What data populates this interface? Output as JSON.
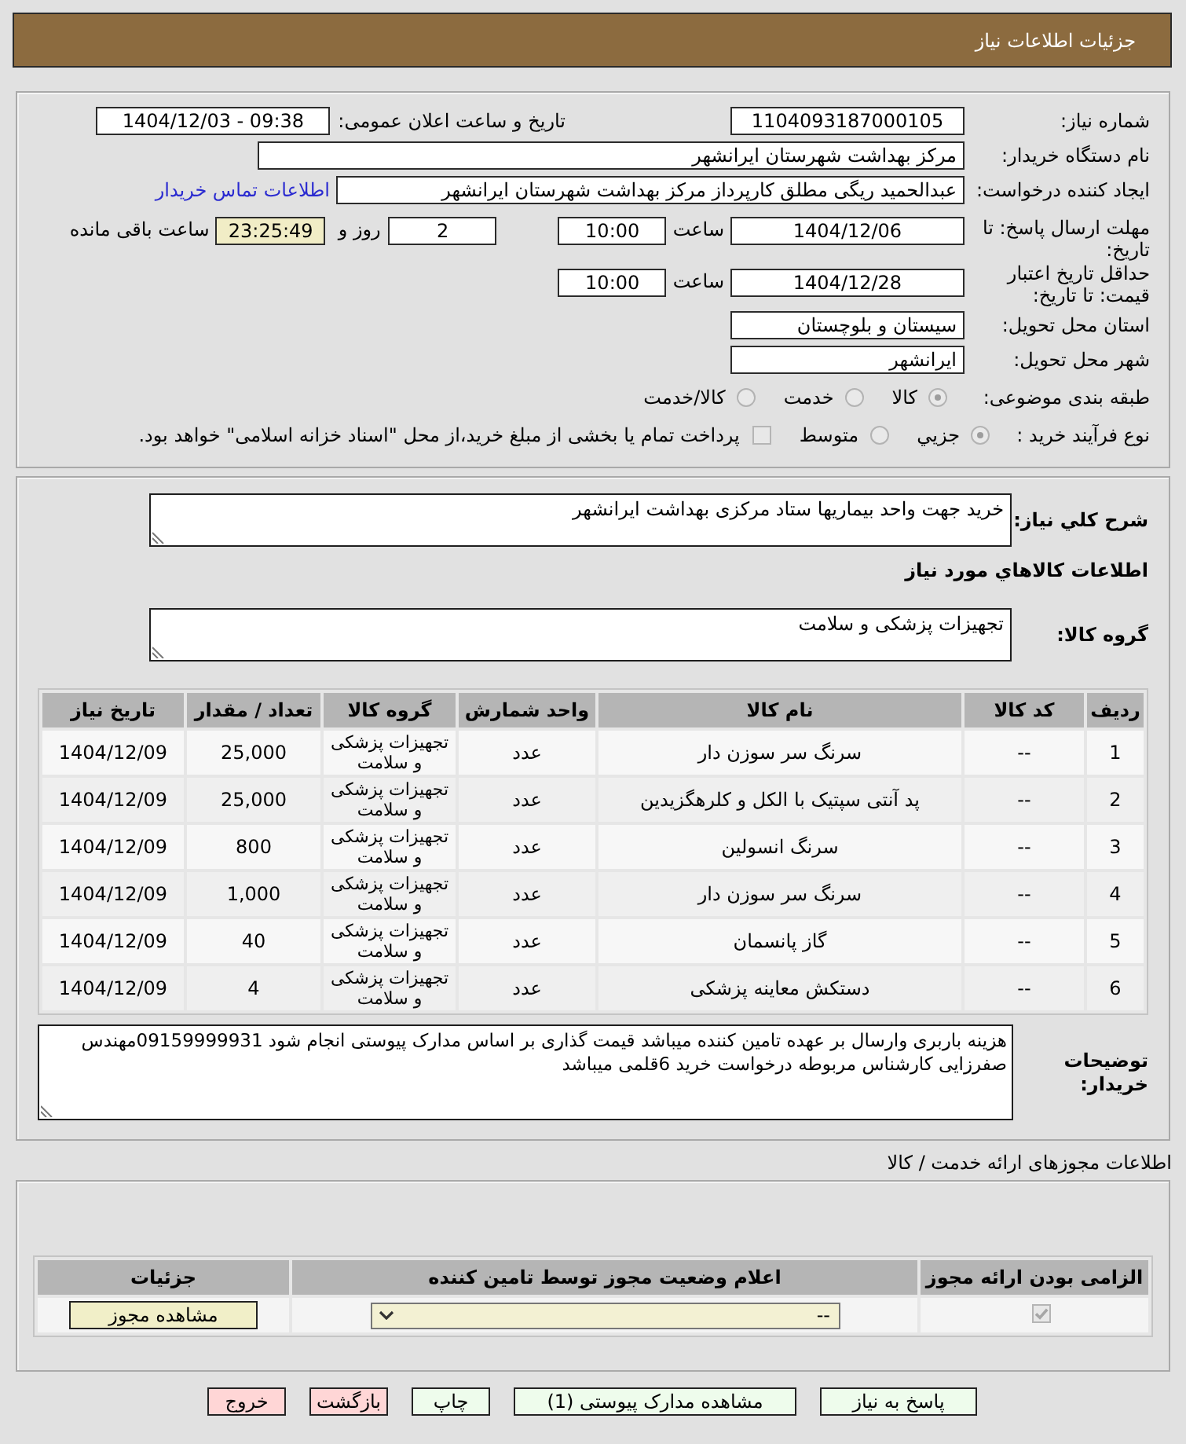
{
  "header": {
    "title": "جزئیات اطلاعات نیاز"
  },
  "details": {
    "need_number": {
      "label": "شماره نیاز:",
      "value": "1104093187000105"
    },
    "announce_date": {
      "label": "تاریخ و ساعت اعلان عمومی:",
      "value": "1404/12/03 - 09:38"
    },
    "buyer_org": {
      "label": "نام دستگاه خریدار:",
      "value": "مرکز بهداشت شهرستان ایرانشهر"
    },
    "requester": {
      "label": "ایجاد کننده درخواست:",
      "value": "عبدالحمید ریگی مطلق کارپرداز مرکز بهداشت شهرستان ایرانشهر",
      "contact_link": "اطلاعات تماس خریدار"
    },
    "reply_deadline": {
      "label": "مهلت ارسال پاسخ: تا تاریخ:",
      "date": "1404/12/06",
      "time_label": "ساعت",
      "time": "10:00",
      "days": "2",
      "days_label": "روز و",
      "remaining": "23:25:49",
      "remaining_label": "ساعت باقی مانده"
    },
    "price_validity": {
      "label": "حداقل تاریخ اعتبار قیمت: تا تاریخ:",
      "date": "1404/12/28",
      "time_label": "ساعت",
      "time": "10:00"
    },
    "delivery_province": {
      "label": "استان محل تحویل:",
      "value": "سیستان و بلوچستان"
    },
    "delivery_city": {
      "label": "شهر محل تحویل:",
      "value": "ایرانشهر"
    },
    "subject_category": {
      "label": "طبقه بندی موضوعی:",
      "options": [
        {
          "label": "کالا",
          "selected": true,
          "disabled": true
        },
        {
          "label": "خدمت",
          "selected": false,
          "disabled": true
        },
        {
          "label": "کالا/خدمت",
          "selected": false,
          "disabled": true
        }
      ]
    },
    "purchase_process": {
      "label": "نوع فرآیند خرید :",
      "options": [
        {
          "label": "جزيي",
          "selected": true,
          "disabled": true
        },
        {
          "label": "متوسط",
          "selected": false,
          "disabled": true
        }
      ],
      "treasury": {
        "label": "پرداخت تمام یا بخشی از مبلغ خرید،از محل \"اسناد خزانه اسلامی\" خواهد بود.",
        "checked": false,
        "disabled": true
      }
    }
  },
  "need_description": {
    "label": "شرح کلي نياز:",
    "value": "خرید جهت واحد بیماریها ستاد مرکزی بهداشت ایرانشهر"
  },
  "goods_section_title": "اطلاعات كالاهاي مورد نياز",
  "goods_group": {
    "label": "گروه کالا:",
    "value": "تجهیزات پزشکی و سلامت"
  },
  "items_table": {
    "columns": [
      "ردیف",
      "کد کالا",
      "نام کالا",
      "واحد شمارش",
      "گروه کالا",
      "تعداد / مقدار",
      "تاریخ نیاز"
    ],
    "rows": [
      [
        "1",
        "--",
        "سرنگ سر سوزن دار",
        "عدد",
        "تجهیزات پزشکی و سلامت",
        "25,000",
        "1404/12/09"
      ],
      [
        "2",
        "--",
        "پد آنتی سپتیک با الکل و کلرهگزیدین",
        "عدد",
        "تجهیزات پزشکی و سلامت",
        "25,000",
        "1404/12/09"
      ],
      [
        "3",
        "--",
        "سرنگ انسولین",
        "عدد",
        "تجهیزات پزشکی و سلامت",
        "800",
        "1404/12/09"
      ],
      [
        "4",
        "--",
        "سرنگ سر سوزن دار",
        "عدد",
        "تجهیزات پزشکی و سلامت",
        "1,000",
        "1404/12/09"
      ],
      [
        "5",
        "--",
        "گاز پانسمان",
        "عدد",
        "تجهیزات پزشکی و سلامت",
        "40",
        "1404/12/09"
      ],
      [
        "6",
        "--",
        "دستکش معاینه پزشکی",
        "عدد",
        "تجهیزات پزشکی و سلامت",
        "4",
        "1404/12/09"
      ]
    ]
  },
  "buyer_notes": {
    "label": "توضیحات خریدار:",
    "value": "هزینه باربری وارسال بر عهده تامین کننده میباشد قیمت گذاری بر اساس مدارک پیوستی انجام شود 09159999931مهندس صفرزایی کارشناس مربوطه درخواست خرید 6قلمی میباشد"
  },
  "permits": {
    "title": "اطلاعات مجوزهای ارائه خدمت / کالا",
    "columns": [
      "الزامی بودن ارائه مجوز",
      "اعلام وضعیت مجوز توسط تامین کننده",
      "جزئیات"
    ],
    "rows": [
      {
        "required": {
          "checked": true,
          "disabled": true
        },
        "status": "--",
        "details_button": "مشاهده مجوز"
      }
    ]
  },
  "actions": [
    {
      "label": "پاسخ به نیاز",
      "kind": "action"
    },
    {
      "label": "مشاهده مدارک پیوستی (1)",
      "kind": "action"
    },
    {
      "label": "چاپ",
      "kind": "action"
    },
    {
      "label": "بازگشت",
      "kind": "cancel"
    },
    {
      "label": "خروج",
      "kind": "cancel"
    }
  ]
}
